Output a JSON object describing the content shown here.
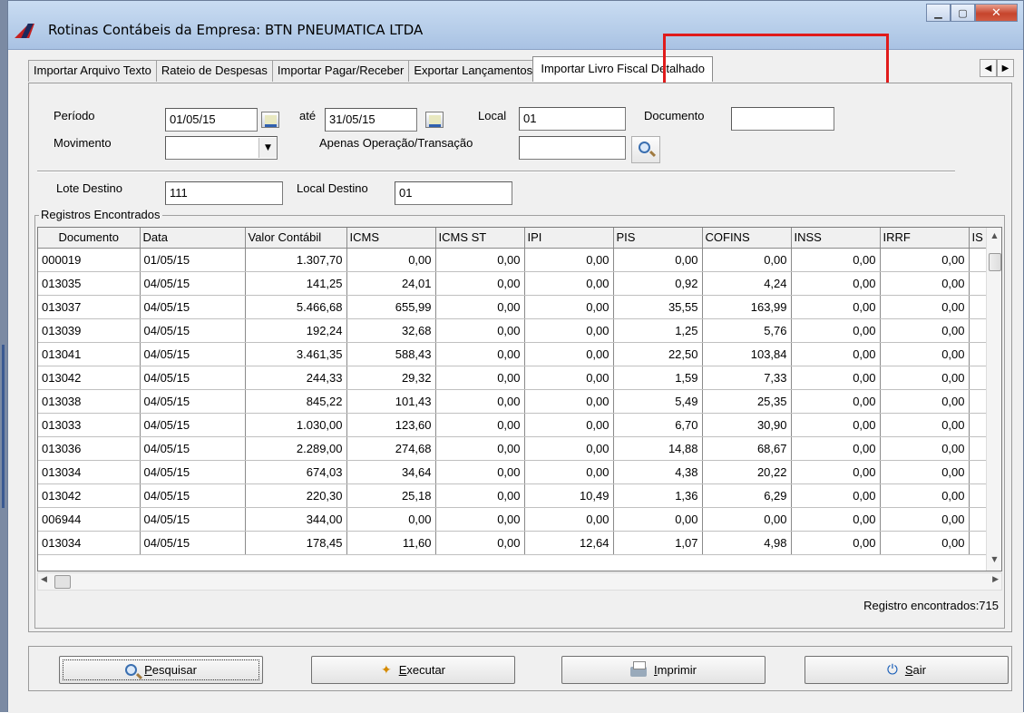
{
  "window": {
    "title": "Rotinas Contábeis da Empresa: BTN PNEUMATICA LTDA",
    "minimize": "▁",
    "maximize": "▢",
    "close": "✕"
  },
  "tabs": [
    {
      "label": "Importar Arquivo Texto"
    },
    {
      "label": "Rateio de Despesas"
    },
    {
      "label": "Importar Pagar/Receber"
    },
    {
      "label": "Exportar Lançamentos"
    },
    {
      "label": "Importar Livro Fiscal Detalhado",
      "active": true
    }
  ],
  "tab_scroll": {
    "left": "◀",
    "right": "▶"
  },
  "form": {
    "periodo_label": "Período",
    "periodo_inicio": "01/05/15",
    "ate_label": "até",
    "periodo_fim": "31/05/15",
    "local_label": "Local",
    "local_value": "01",
    "documento_label": "Documento",
    "documento_value": "",
    "movimento_label": "Movimento",
    "movimento_value": "",
    "apenas_label": "Apenas Operação/Transação",
    "apenas_value": "",
    "lote_label": "Lote Destino",
    "lote_value": "111",
    "local_destino_label": "Local Destino",
    "local_destino_value": "01"
  },
  "grid": {
    "group_title": "Registros Encontrados",
    "columns": [
      "Documento",
      "Data",
      "Valor Contábil",
      "ICMS",
      "ICMS ST",
      "IPI",
      "PIS",
      "COFINS",
      "INSS",
      "IRRF",
      "IS"
    ],
    "rows": [
      [
        "000019",
        "01/05/15",
        "1.307,70",
        "0,00",
        "0,00",
        "0,00",
        "0,00",
        "0,00",
        "0,00",
        "0,00"
      ],
      [
        "013035",
        "04/05/15",
        "141,25",
        "24,01",
        "0,00",
        "0,00",
        "0,92",
        "4,24",
        "0,00",
        "0,00"
      ],
      [
        "013037",
        "04/05/15",
        "5.466,68",
        "655,99",
        "0,00",
        "0,00",
        "35,55",
        "163,99",
        "0,00",
        "0,00"
      ],
      [
        "013039",
        "04/05/15",
        "192,24",
        "32,68",
        "0,00",
        "0,00",
        "1,25",
        "5,76",
        "0,00",
        "0,00"
      ],
      [
        "013041",
        "04/05/15",
        "3.461,35",
        "588,43",
        "0,00",
        "0,00",
        "22,50",
        "103,84",
        "0,00",
        "0,00"
      ],
      [
        "013042",
        "04/05/15",
        "244,33",
        "29,32",
        "0,00",
        "0,00",
        "1,59",
        "7,33",
        "0,00",
        "0,00"
      ],
      [
        "013038",
        "04/05/15",
        "845,22",
        "101,43",
        "0,00",
        "0,00",
        "5,49",
        "25,35",
        "0,00",
        "0,00"
      ],
      [
        "013033",
        "04/05/15",
        "1.030,00",
        "123,60",
        "0,00",
        "0,00",
        "6,70",
        "30,90",
        "0,00",
        "0,00"
      ],
      [
        "013036",
        "04/05/15",
        "2.289,00",
        "274,68",
        "0,00",
        "0,00",
        "14,88",
        "68,67",
        "0,00",
        "0,00"
      ],
      [
        "013034",
        "04/05/15",
        "674,03",
        "34,64",
        "0,00",
        "0,00",
        "4,38",
        "20,22",
        "0,00",
        "0,00"
      ],
      [
        "013042",
        "04/05/15",
        "220,30",
        "25,18",
        "0,00",
        "10,49",
        "1,36",
        "6,29",
        "0,00",
        "0,00"
      ],
      [
        "006944",
        "04/05/15",
        "344,00",
        "0,00",
        "0,00",
        "0,00",
        "0,00",
        "0,00",
        "0,00",
        "0,00"
      ],
      [
        "013034",
        "04/05/15",
        "178,45",
        "11,60",
        "0,00",
        "12,64",
        "1,07",
        "4,98",
        "0,00",
        "0,00"
      ]
    ],
    "status": "Registro encontrados:715"
  },
  "buttons": {
    "pesquisar": {
      "u": "P",
      "rest": "esquisar"
    },
    "executar": {
      "u": "E",
      "rest": "xecutar"
    },
    "imprimir": {
      "u": "I",
      "rest": "mprimir"
    },
    "sair": {
      "u": "S",
      "rest": "air"
    }
  },
  "colors": {
    "highlight": "#e01b1b",
    "titlebar": "#b6cde9"
  }
}
